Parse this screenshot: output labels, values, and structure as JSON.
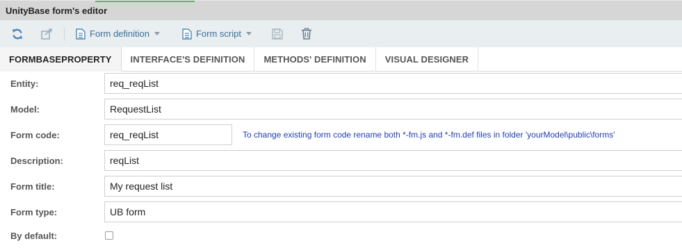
{
  "window": {
    "title": "UnityBase form's editor"
  },
  "toolbar": {
    "refresh_icon": "refresh-icon",
    "export_icon": "share-icon",
    "form_definition_label": "Form definition",
    "form_script_label": "Form script",
    "save_icon": "floppy-icon",
    "delete_icon": "trash-icon",
    "accent_color": "#3b6f99"
  },
  "tabs": [
    {
      "label": "FORMBASEPROPERTY",
      "active": true
    },
    {
      "label": "INTERFACE'S DEFINITION"
    },
    {
      "label": "METHODS' DEFINITION"
    },
    {
      "label": "VISUAL DESIGNER"
    }
  ],
  "form": {
    "entity": {
      "label": "Entity:",
      "value": "req_reqList"
    },
    "model": {
      "label": "Model:",
      "value": "RequestList"
    },
    "form_code": {
      "label": "Form code:",
      "value": "req_reqList",
      "hint": "To change existing form code rename both *-fm.js and *-fm.def files in folder 'yourModel\\public\\forms'"
    },
    "description": {
      "label": "Description:",
      "value": "reqList"
    },
    "form_title": {
      "label": "Form title:",
      "value": "My request list"
    },
    "form_type": {
      "label": "Form type:",
      "value": "UB form"
    },
    "by_default": {
      "label": "By default:",
      "checked": false
    }
  }
}
